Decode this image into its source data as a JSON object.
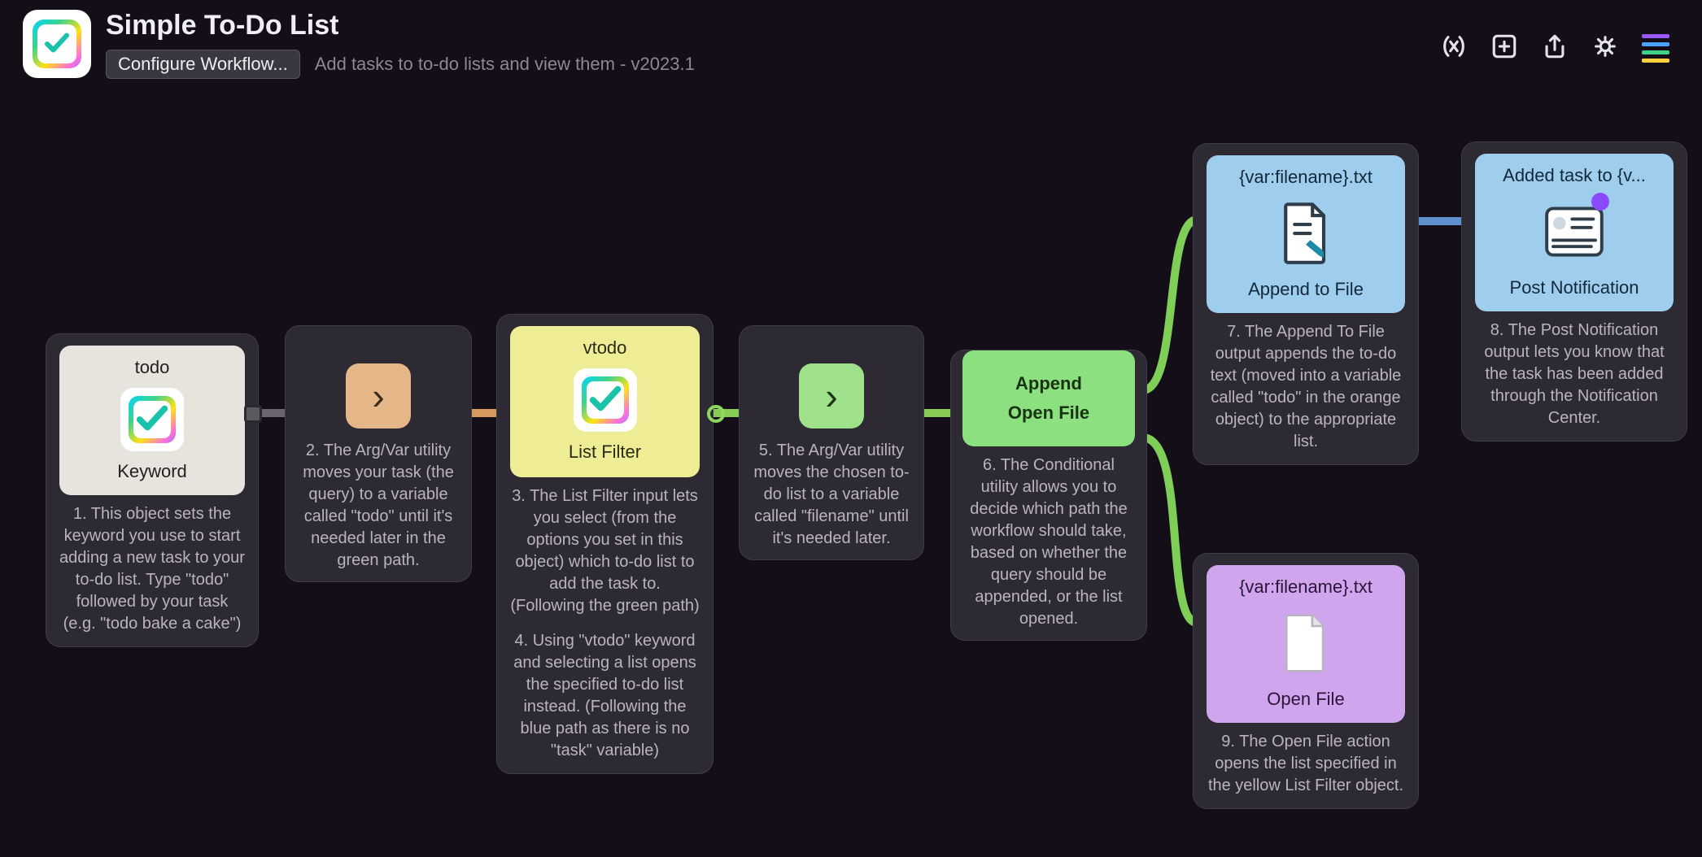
{
  "header": {
    "title": "Simple To-Do List",
    "configure_label": "Configure Workflow...",
    "subtitle": "Add tasks to to-do lists and view them - v2023.1"
  },
  "nodes": {
    "keyword": {
      "title": "todo",
      "label": "Keyword",
      "desc": "1. This object sets the keyword you use to start adding a new task to your to-do list. Type \"todo\" followed by your task (e.g. \"todo bake a cake\")"
    },
    "arg1": {
      "desc": "2. The Arg/Var utility moves your task (the query) to a variable called \"todo\" until it's needed later in the green path."
    },
    "filter": {
      "title": "vtodo",
      "label": "List Filter",
      "desc3": "3. The List Filter input lets you select (from the options you set in this object) which to-do list to add the task to. (Following the green path)",
      "desc4": "4. Using \"vtodo\" keyword and selecting a list opens the specified to-do list instead. (Following the blue path as there is no \"task\" variable)"
    },
    "arg2": {
      "desc": "5. The Arg/Var utility moves the chosen to-do list to a variable called \"filename\" until it's needed later."
    },
    "cond": {
      "opt1": "Append",
      "opt2": "Open File",
      "desc": "6. The Conditional utility allows you to decide which path the workflow should take, based on whether the query should be appended, or the list opened."
    },
    "append": {
      "title": "{var:filename}.txt",
      "label": "Append to File",
      "desc": "7. The Append To File output appends the to-do text (moved into a variable called \"todo\" in the orange object) to the appropriate list."
    },
    "notify": {
      "title": "Added task to {v...",
      "label": "Post Notification",
      "desc": "8. The Post Notification output lets you know that the task has been added through the Notification Center."
    },
    "open": {
      "title": "{var:filename}.txt",
      "label": "Open File",
      "desc": "9. The Open File action opens the list specified in the yellow List Filter object."
    }
  }
}
